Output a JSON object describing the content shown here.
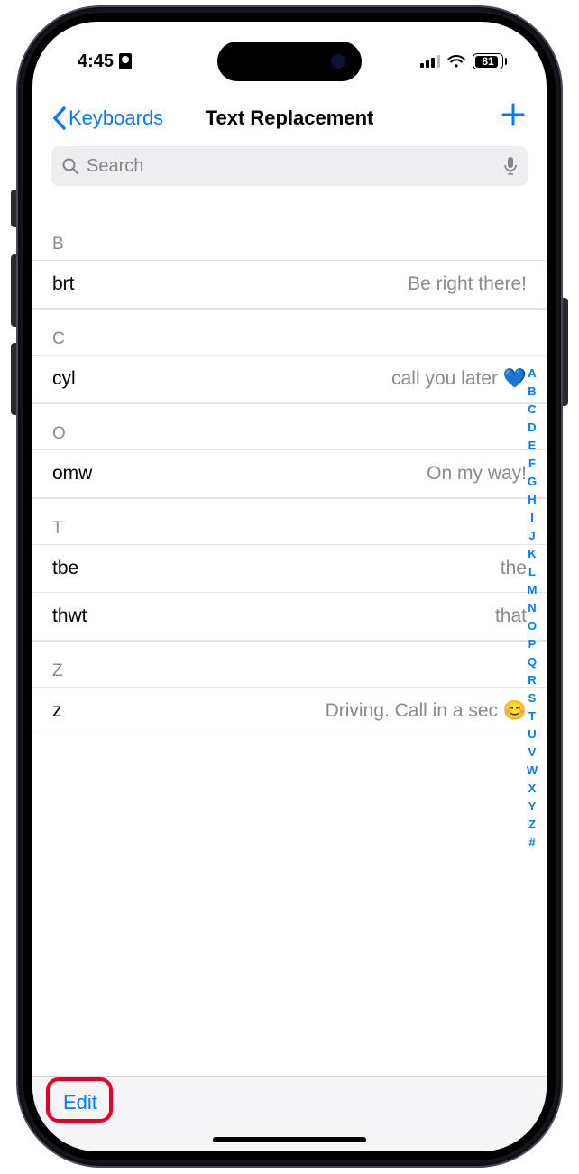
{
  "status": {
    "time": "4:45",
    "battery_pct": "81"
  },
  "nav": {
    "back_label": "Keyboards",
    "title": "Text Replacement"
  },
  "search": {
    "placeholder": "Search"
  },
  "sections": [
    {
      "letter": "B",
      "rows": [
        {
          "shortcut": "brt",
          "phrase": "Be right there!"
        }
      ]
    },
    {
      "letter": "C",
      "rows": [
        {
          "shortcut": "cyl",
          "phrase": "call you later 💙"
        }
      ]
    },
    {
      "letter": "O",
      "rows": [
        {
          "shortcut": "omw",
          "phrase": "On my way!"
        }
      ]
    },
    {
      "letter": "T",
      "rows": [
        {
          "shortcut": "tbe",
          "phrase": "the"
        },
        {
          "shortcut": "thwt",
          "phrase": "that"
        }
      ]
    },
    {
      "letter": "Z",
      "rows": [
        {
          "shortcut": "z",
          "phrase": "Driving. Call in a sec 😊"
        }
      ]
    }
  ],
  "index_letters": [
    "A",
    "B",
    "C",
    "D",
    "E",
    "F",
    "G",
    "H",
    "I",
    "J",
    "K",
    "L",
    "M",
    "N",
    "O",
    "P",
    "Q",
    "R",
    "S",
    "T",
    "U",
    "V",
    "W",
    "X",
    "Y",
    "Z",
    "#"
  ],
  "toolbar": {
    "edit_label": "Edit"
  }
}
